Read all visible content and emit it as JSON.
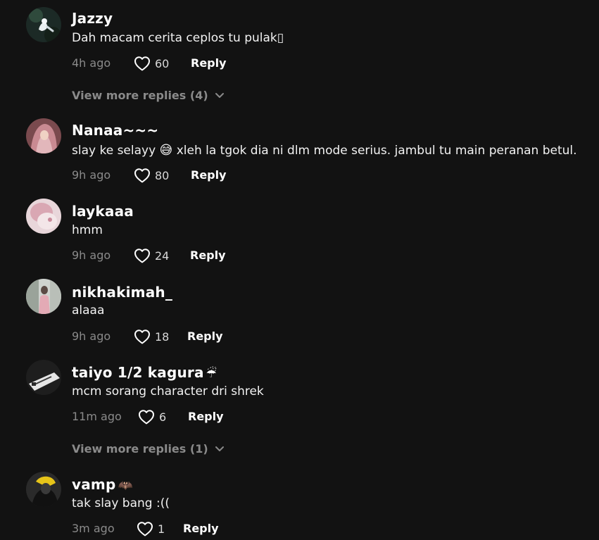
{
  "comments": [
    {
      "username": "Jazzy",
      "username_emoji": "",
      "text": "Dah macam cerita ceplos tu pulak▯",
      "text_emoji": "",
      "text_after": "",
      "time": "4h ago",
      "likes": "60",
      "reply_label": "Reply",
      "view_more": "View more replies (4)"
    },
    {
      "username": "Nanaa~~~",
      "username_emoji": "",
      "text": "slay ke selayy ",
      "text_emoji": "😅",
      "text_after": " xleh la tgok dia ni dlm mode serius. jambul tu main peranan betul.",
      "time": "9h ago",
      "likes": "80",
      "reply_label": "Reply",
      "view_more": ""
    },
    {
      "username": "laykaaa",
      "username_emoji": "",
      "text": "hmm",
      "text_emoji": "",
      "text_after": "",
      "time": "9h ago",
      "likes": "24",
      "reply_label": "Reply",
      "view_more": ""
    },
    {
      "username": "nikhakimah_",
      "username_emoji": "",
      "text": "alaaa",
      "text_emoji": "",
      "text_after": "",
      "time": "9h ago",
      "likes": "18",
      "reply_label": "Reply",
      "view_more": ""
    },
    {
      "username": "taiyo 1/2 kagura",
      "username_emoji": "☔",
      "text": "mcm sorang character dri shrek",
      "text_emoji": "",
      "text_after": "",
      "time": "11m ago",
      "likes": "6",
      "reply_label": "Reply",
      "view_more": "View more replies (1)"
    },
    {
      "username": "vamp",
      "username_emoji": "🦇",
      "text": "tak slay bang :((",
      "text_emoji": "",
      "text_after": "",
      "time": "3m ago",
      "likes": "1",
      "reply_label": "Reply",
      "view_more": ""
    }
  ],
  "icons": {
    "like": "heart-outline-icon",
    "expand": "chevron-down-icon"
  },
  "colors": {
    "background": "#121212",
    "text_primary": "#ffffff",
    "text_secondary": "#8a8a8a"
  }
}
